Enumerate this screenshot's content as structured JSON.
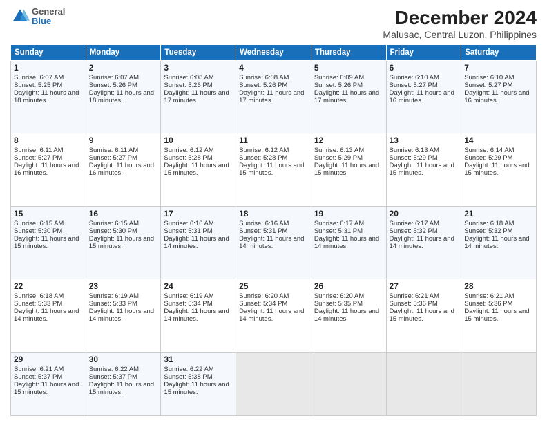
{
  "header": {
    "logo": {
      "general": "General",
      "blue": "Blue"
    },
    "title": "December 2024",
    "location": "Malusac, Central Luzon, Philippines"
  },
  "days_of_week": [
    "Sunday",
    "Monday",
    "Tuesday",
    "Wednesday",
    "Thursday",
    "Friday",
    "Saturday"
  ],
  "weeks": [
    [
      {
        "day": "1",
        "sunrise": "6:07 AM",
        "sunset": "5:25 PM",
        "daylight": "11 hours and 18 minutes."
      },
      {
        "day": "2",
        "sunrise": "6:07 AM",
        "sunset": "5:26 PM",
        "daylight": "11 hours and 18 minutes."
      },
      {
        "day": "3",
        "sunrise": "6:08 AM",
        "sunset": "5:26 PM",
        "daylight": "11 hours and 17 minutes."
      },
      {
        "day": "4",
        "sunrise": "6:08 AM",
        "sunset": "5:26 PM",
        "daylight": "11 hours and 17 minutes."
      },
      {
        "day": "5",
        "sunrise": "6:09 AM",
        "sunset": "5:26 PM",
        "daylight": "11 hours and 17 minutes."
      },
      {
        "day": "6",
        "sunrise": "6:10 AM",
        "sunset": "5:27 PM",
        "daylight": "11 hours and 16 minutes."
      },
      {
        "day": "7",
        "sunrise": "6:10 AM",
        "sunset": "5:27 PM",
        "daylight": "11 hours and 16 minutes."
      }
    ],
    [
      {
        "day": "8",
        "sunrise": "6:11 AM",
        "sunset": "5:27 PM",
        "daylight": "11 hours and 16 minutes."
      },
      {
        "day": "9",
        "sunrise": "6:11 AM",
        "sunset": "5:27 PM",
        "daylight": "11 hours and 16 minutes."
      },
      {
        "day": "10",
        "sunrise": "6:12 AM",
        "sunset": "5:28 PM",
        "daylight": "11 hours and 15 minutes."
      },
      {
        "day": "11",
        "sunrise": "6:12 AM",
        "sunset": "5:28 PM",
        "daylight": "11 hours and 15 minutes."
      },
      {
        "day": "12",
        "sunrise": "6:13 AM",
        "sunset": "5:29 PM",
        "daylight": "11 hours and 15 minutes."
      },
      {
        "day": "13",
        "sunrise": "6:13 AM",
        "sunset": "5:29 PM",
        "daylight": "11 hours and 15 minutes."
      },
      {
        "day": "14",
        "sunrise": "6:14 AM",
        "sunset": "5:29 PM",
        "daylight": "11 hours and 15 minutes."
      }
    ],
    [
      {
        "day": "15",
        "sunrise": "6:15 AM",
        "sunset": "5:30 PM",
        "daylight": "11 hours and 15 minutes."
      },
      {
        "day": "16",
        "sunrise": "6:15 AM",
        "sunset": "5:30 PM",
        "daylight": "11 hours and 15 minutes."
      },
      {
        "day": "17",
        "sunrise": "6:16 AM",
        "sunset": "5:31 PM",
        "daylight": "11 hours and 14 minutes."
      },
      {
        "day": "18",
        "sunrise": "6:16 AM",
        "sunset": "5:31 PM",
        "daylight": "11 hours and 14 minutes."
      },
      {
        "day": "19",
        "sunrise": "6:17 AM",
        "sunset": "5:31 PM",
        "daylight": "11 hours and 14 minutes."
      },
      {
        "day": "20",
        "sunrise": "6:17 AM",
        "sunset": "5:32 PM",
        "daylight": "11 hours and 14 minutes."
      },
      {
        "day": "21",
        "sunrise": "6:18 AM",
        "sunset": "5:32 PM",
        "daylight": "11 hours and 14 minutes."
      }
    ],
    [
      {
        "day": "22",
        "sunrise": "6:18 AM",
        "sunset": "5:33 PM",
        "daylight": "11 hours and 14 minutes."
      },
      {
        "day": "23",
        "sunrise": "6:19 AM",
        "sunset": "5:33 PM",
        "daylight": "11 hours and 14 minutes."
      },
      {
        "day": "24",
        "sunrise": "6:19 AM",
        "sunset": "5:34 PM",
        "daylight": "11 hours and 14 minutes."
      },
      {
        "day": "25",
        "sunrise": "6:20 AM",
        "sunset": "5:34 PM",
        "daylight": "11 hours and 14 minutes."
      },
      {
        "day": "26",
        "sunrise": "6:20 AM",
        "sunset": "5:35 PM",
        "daylight": "11 hours and 14 minutes."
      },
      {
        "day": "27",
        "sunrise": "6:21 AM",
        "sunset": "5:36 PM",
        "daylight": "11 hours and 15 minutes."
      },
      {
        "day": "28",
        "sunrise": "6:21 AM",
        "sunset": "5:36 PM",
        "daylight": "11 hours and 15 minutes."
      }
    ],
    [
      {
        "day": "29",
        "sunrise": "6:21 AM",
        "sunset": "5:37 PM",
        "daylight": "11 hours and 15 minutes."
      },
      {
        "day": "30",
        "sunrise": "6:22 AM",
        "sunset": "5:37 PM",
        "daylight": "11 hours and 15 minutes."
      },
      {
        "day": "31",
        "sunrise": "6:22 AM",
        "sunset": "5:38 PM",
        "daylight": "11 hours and 15 minutes."
      },
      null,
      null,
      null,
      null
    ]
  ]
}
